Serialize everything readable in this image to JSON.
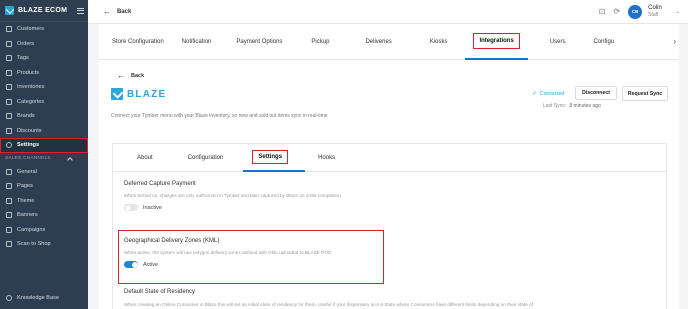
{
  "sidebar": {
    "brand": "BLAZE ECOM",
    "items": [
      {
        "label": "Customers",
        "icon": "users-icon"
      },
      {
        "label": "Orders",
        "icon": "orders-icon"
      },
      {
        "label": "Tags",
        "icon": "tag-icon"
      },
      {
        "label": "Products",
        "icon": "box-icon"
      },
      {
        "label": "Inventories",
        "icon": "inventory-icon"
      },
      {
        "label": "Categories",
        "icon": "categories-icon"
      },
      {
        "label": "Brands",
        "icon": "brand-icon"
      },
      {
        "label": "Discounts",
        "icon": "discount-icon"
      },
      {
        "label": "Settings",
        "icon": "gear-icon"
      }
    ],
    "section_title": "SALES CHANNELS",
    "channel_items": [
      {
        "label": "General",
        "icon": "globe-icon"
      },
      {
        "label": "Pages",
        "icon": "pages-icon"
      },
      {
        "label": "Theme",
        "icon": "theme-icon"
      },
      {
        "label": "Banners",
        "icon": "banner-icon"
      },
      {
        "label": "Campaigns",
        "icon": "campaign-icon"
      },
      {
        "label": "Scan to Shop",
        "icon": "scan-icon"
      }
    ],
    "knowledge_base": "Knowledge Base",
    "active_item": "Settings"
  },
  "topbar": {
    "back_label": "Back",
    "user_initials": "CB",
    "user_name": "Colin",
    "user_role": "Staff"
  },
  "tabs": [
    "Store Configuration",
    "Notification",
    "Payment Options",
    "Pickup",
    "Deliveries",
    "Kiosks",
    "Integrations",
    "Users",
    "Configu"
  ],
  "active_tab": "Integrations",
  "integration": {
    "back_label": "Back",
    "logo_text": "BLAZE",
    "description": "Connect your Tymber menu with your Blaze inventory, so new and sold out items sync in real-time",
    "status": "Connected",
    "disconnect_label": "Disconnect",
    "request_sync_label": "Request Sync",
    "last_sync_label": "Last Sync:",
    "last_sync_value": "8 minutes ago"
  },
  "subtabs": [
    "About",
    "Configuration",
    "Settings",
    "Hooks"
  ],
  "active_subtab": "Settings",
  "settings": {
    "deferred": {
      "title": "Deferred Capture Payment",
      "description": "When turned on, charges are only authorized in Tymber and later captured by Blaze on order completion",
      "state_label": "Inactive"
    },
    "geo": {
      "title": "Geographical Delivery Zones (KML)",
      "description": "When active, the system will use polygon delivery zones defined with KML uploaded to BLAZE POS",
      "state_label": "Active"
    },
    "residency": {
      "title": "Default State of Residency",
      "description": "When creating an Online Consumer in Blaze this will set an initial state of residency for them. Useful if your dispensary is in a State where Consumers have different limits depending on their state of"
    }
  },
  "colors": {
    "sidebar_bg": "#2c3e50",
    "accent": "#1e73c8",
    "blaze_brand": "#29a7df",
    "highlight_box": "#e0202a",
    "toggle_on": "#1e88d8"
  }
}
